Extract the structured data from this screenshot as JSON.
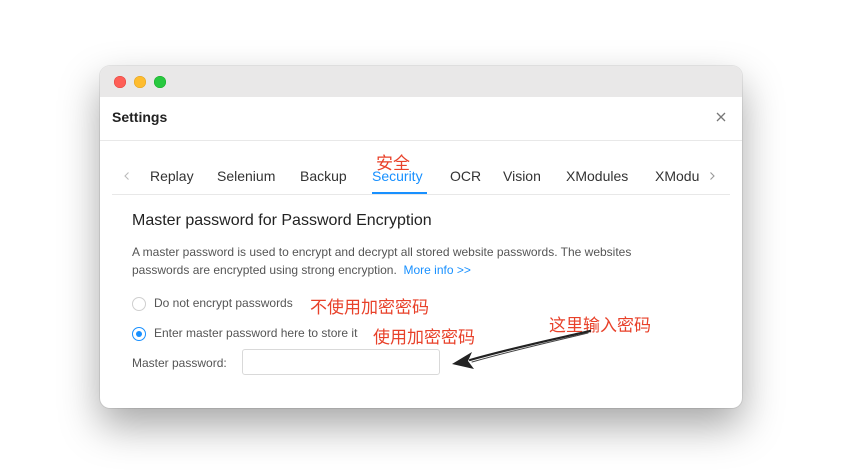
{
  "window": {
    "title": "Settings"
  },
  "tabs": {
    "items": [
      {
        "label": "Replay"
      },
      {
        "label": "Selenium"
      },
      {
        "label": "Backup"
      },
      {
        "label": "Security"
      },
      {
        "label": "OCR"
      },
      {
        "label": "Vision"
      },
      {
        "label": "XModules"
      },
      {
        "label": "XModu"
      }
    ],
    "active": "Security"
  },
  "security": {
    "section_title": "Master password for Password Encryption",
    "description": "A master password is used to encrypt and decrypt all stored website passwords. The websites passwords are encrypted using strong encryption.",
    "more_info": "More info >>",
    "option_no_encrypt": "Do not encrypt passwords",
    "option_master": "Enter master password here to store it",
    "selected_option": "Enter master password here to store it",
    "password_label": "Master password:",
    "password_value": ""
  },
  "annotations": {
    "security_tab": "安全",
    "no_encrypt": "不使用加密密码",
    "use_encrypt": "使用加密密码",
    "enter_here": "这里输入密码"
  },
  "colors": {
    "accent": "#1890ff",
    "annotation": "#e8412a",
    "traffic_close": "#fe5f57",
    "traffic_min": "#febc2e",
    "traffic_max": "#28c840"
  },
  "icons": {
    "close": "close-icon",
    "tab_prev": "chevron-left-icon",
    "tab_next": "chevron-right-icon"
  }
}
